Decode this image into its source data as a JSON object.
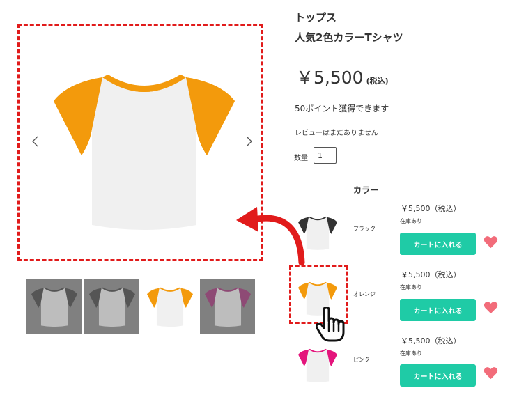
{
  "product": {
    "category": "トップス",
    "title": "人気2色カラーTシャツ",
    "price": "￥5,500",
    "price_tax": "(税込)",
    "points": "50ポイント獲得できます",
    "reviews": "レビューはまだありません",
    "quantity_label": "数量",
    "quantity_value": "1",
    "color_heading": "カラー"
  },
  "gallery": {
    "prev_icon": "chevron-left-icon",
    "next_icon": "chevron-right-icon",
    "thumbnails": [
      "black",
      "black",
      "orange",
      "purple"
    ]
  },
  "variants": [
    {
      "name": "ブラック",
      "price": "￥5,500（税込）",
      "stock": "在庫あり",
      "button": "カートに入れる",
      "sleeve_color": "#333333"
    },
    {
      "name": "オレンジ",
      "price": "￥5,500（税込）",
      "stock": "在庫あり",
      "button": "カートに入れる",
      "sleeve_color": "#f39a0c"
    },
    {
      "name": "ピンク",
      "price": "￥5,500（税込）",
      "stock": "在庫あり",
      "button": "カートに入れる",
      "sleeve_color": "#e4157c"
    }
  ],
  "colors": {
    "orange": "#f39a0c",
    "black": "#333333",
    "pink": "#e4157c",
    "purple": "#7a1a58",
    "body": "#f0f0f0",
    "cart_button": "#1fcba6",
    "heart": "#f26c7a",
    "annotation_red": "#e11b1b"
  },
  "icons": [
    "heart-icon",
    "hand-pointer-icon",
    "curved-arrow-icon"
  ]
}
